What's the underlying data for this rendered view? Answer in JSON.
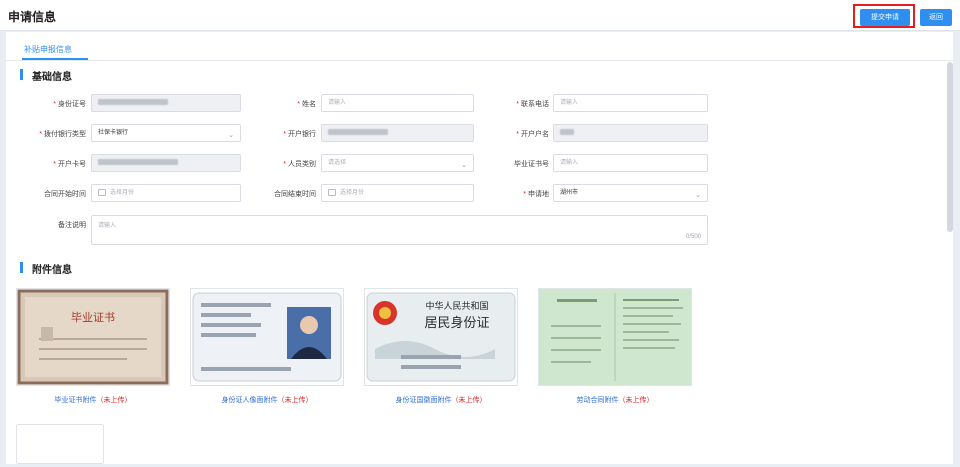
{
  "header": {
    "title": "申请信息",
    "submit_label": "提交申请",
    "back_label": "返回"
  },
  "tabs": [
    {
      "label": "补贴申报信息",
      "active": true
    }
  ],
  "sections": {
    "basic": "基础信息",
    "attachments": "附件信息"
  },
  "form": {
    "id_number": {
      "label": "身份证号",
      "required": true,
      "value": "(masked)"
    },
    "name": {
      "label": "姓名",
      "required": true,
      "placeholder": "请输入"
    },
    "phone": {
      "label": "联系电话",
      "required": true,
      "placeholder": "请输入"
    },
    "bank_type": {
      "label": "拨付银行类型",
      "required": true,
      "value": "社保卡银行"
    },
    "bank": {
      "label": "开户银行",
      "required": true,
      "value": "(masked)"
    },
    "account_name": {
      "label": "开户户名",
      "required": true,
      "value": "(masked)"
    },
    "card_number": {
      "label": "开户卡号",
      "required": true,
      "value": "(masked)"
    },
    "person_category": {
      "label": "人员类别",
      "required": true,
      "placeholder": "请选择"
    },
    "grad_cert_number": {
      "label": "毕业证书号",
      "required": false,
      "placeholder": "请输入"
    },
    "contract_start": {
      "label": "合同开始时间",
      "required": false,
      "placeholder": "选择月份"
    },
    "contract_end": {
      "label": "合同结束时间",
      "required": false,
      "placeholder": "选择月份"
    },
    "apply_location": {
      "label": "申请地",
      "required": true,
      "value": "湖州市"
    },
    "remarks": {
      "label": "备注说明",
      "required": false,
      "placeholder": "请输入",
      "counter": "0/500"
    }
  },
  "attachments": [
    {
      "name": "毕业证书附件",
      "status": "（未上传）",
      "image_text": "毕业证书"
    },
    {
      "name": "身份证人像面附件",
      "status": "（未上传）",
      "image_text": ""
    },
    {
      "name": "身份证国徽面附件",
      "status": "（未上传）",
      "image_text": "中华人民共和国 居民身份证"
    },
    {
      "name": "劳动合同附件",
      "status": "（未上传）",
      "image_text": ""
    }
  ],
  "colors": {
    "primary": "#2f8ff0",
    "required": "#e02020",
    "link": "#2f6bd8",
    "highlight": "#e02020"
  }
}
